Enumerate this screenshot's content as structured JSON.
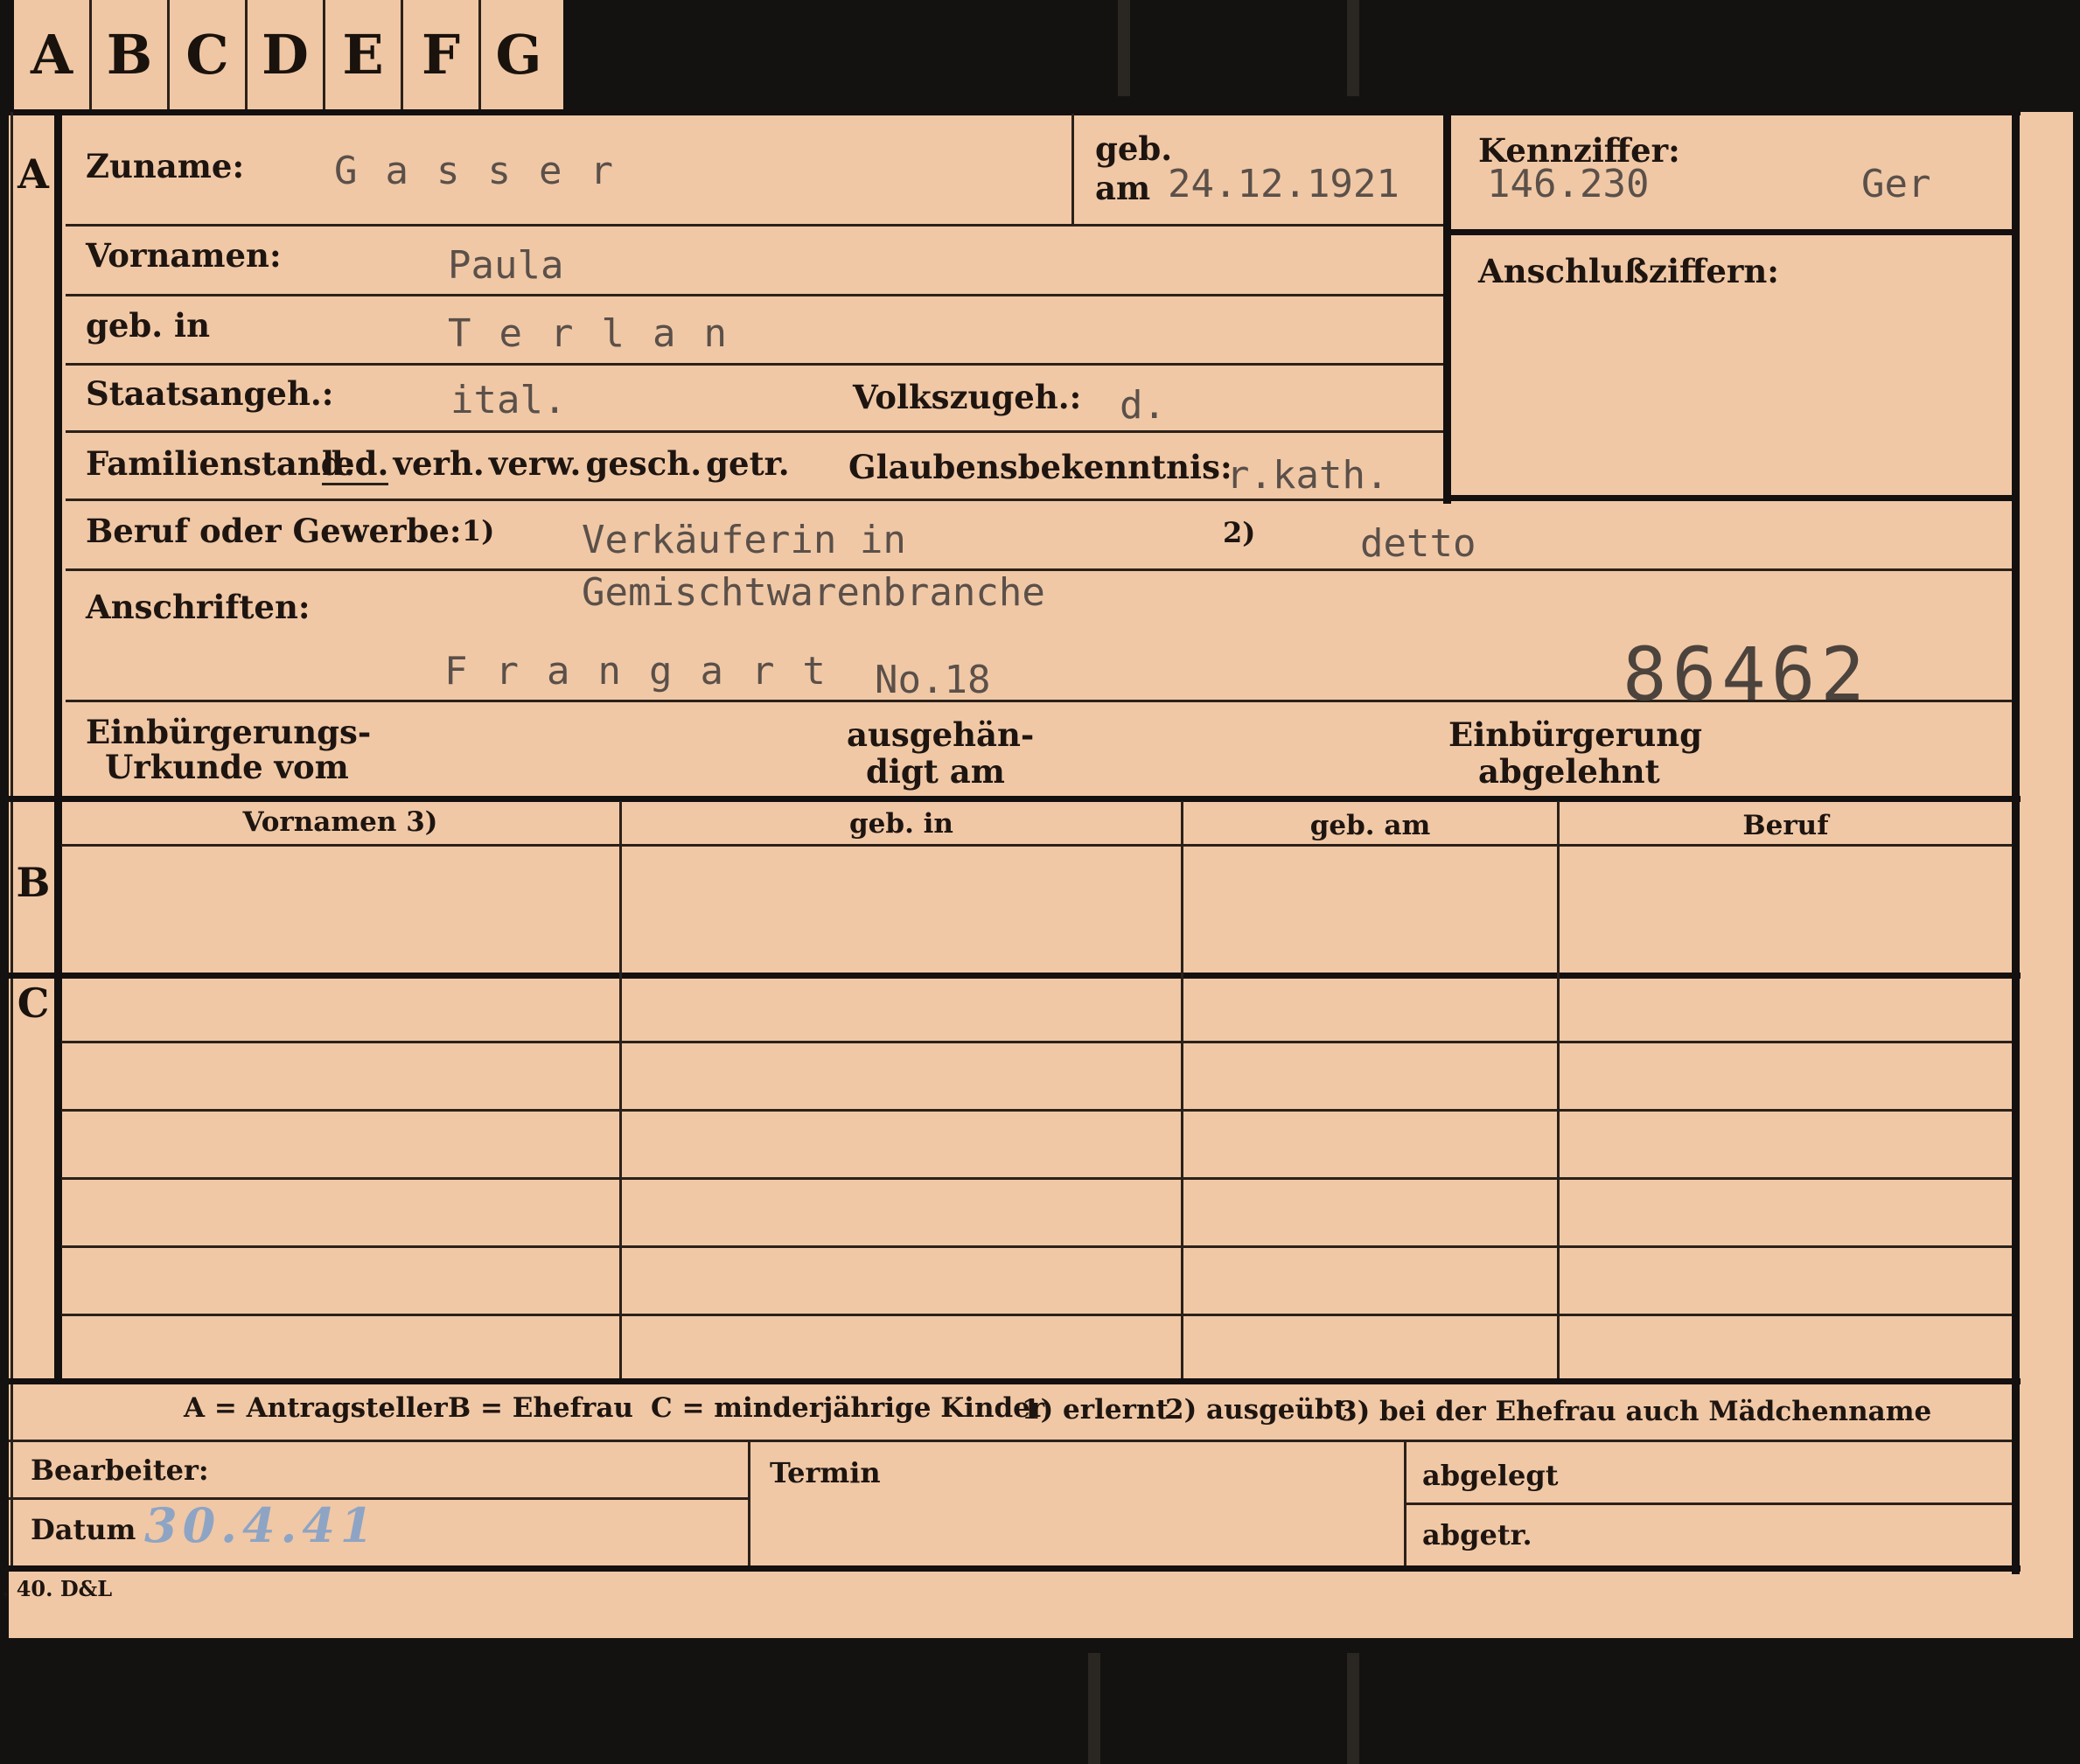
{
  "tabs": [
    "A",
    "B",
    "C",
    "D",
    "E",
    "F",
    "G"
  ],
  "section_a": {
    "letter": "A",
    "zuname_label": "Zuname:",
    "zuname_value": "Gasser",
    "geb_label": "geb.",
    "am_label": "am",
    "geb_am_value": "24.12.1921",
    "kennziffer_label": "Kennziffer:",
    "kennziffer_value": "146.230",
    "kennziffer_suffix": "Ger",
    "anschluss_label": "Anschlußziffern:",
    "vornamen_label": "Vornamen:",
    "vornamen_value": "Paula",
    "geb_in_label": "geb. in",
    "geb_in_value": "Terlan",
    "staats_label": "Staatsangeh.:",
    "staats_value": "ital.",
    "volks_label": "Volkszugeh.:",
    "volks_value": "d.",
    "familienstand_label": "Familienstand:",
    "familienstand_options": [
      "led.",
      "verh.",
      "verw.",
      "gesch.",
      "getr."
    ],
    "familienstand_selected": "led.",
    "glaubens_label": "Glaubensbekenntnis:",
    "glaubens_value": "r.kath.",
    "beruf_label": "Beruf oder Gewerbe:",
    "beruf_mark_1": "1)",
    "beruf_value_1": "Verkäuferin in",
    "beruf_value_1b": "Gemischtwarenbranche",
    "beruf_mark_2": "2)",
    "beruf_value_2": "detto",
    "anschriften_label": "Anschriften:",
    "anschrift_ort": "Frangart",
    "anschrift_nr": "No.18",
    "card_number": "86462",
    "urkunde_label_1": "Einbürgerungs-",
    "urkunde_label_2": "Urkunde vom",
    "ausgehaendigt_label_1": "ausgehän-",
    "ausgehaendigt_label_2": "digt am",
    "abgelehnt_label_1": "Einbürgerung",
    "abgelehnt_label_2": "abgelehnt"
  },
  "section_b": {
    "letter": "B",
    "columns": [
      "Vornamen 3)",
      "geb. in",
      "geb. am",
      "Beruf"
    ]
  },
  "section_c": {
    "letter": "C"
  },
  "legend": {
    "a": "A = Antragsteller",
    "b": "B = Ehefrau",
    "c": "C = minderjährige Kinder",
    "n1": "1) erlernt",
    "n2": "2) ausgeübt",
    "n3": "3) bei der Ehefrau auch Mädchenname"
  },
  "footer": {
    "bearbeiter_label": "Bearbeiter:",
    "datum_label": "Datum",
    "datum_value": "30.4.41",
    "termin_label": "Termin",
    "abgelegt_label": "abgelegt",
    "abgetr_label": "abgetr."
  },
  "imprint": ". 40. D&L"
}
